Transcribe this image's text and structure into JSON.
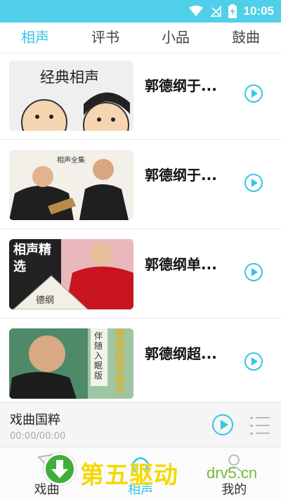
{
  "status_bar": {
    "time": "10:05",
    "icons": [
      "wifi-icon",
      "no-signal-icon",
      "battery-charging-icon"
    ]
  },
  "tabs": [
    {
      "label": "相声",
      "active": true
    },
    {
      "label": "评书",
      "active": false
    },
    {
      "label": "小品",
      "active": false
    },
    {
      "label": "鼓曲",
      "active": false
    }
  ],
  "items": [
    {
      "title": "郭德纲于...",
      "thumb_text": "经典相声",
      "thumb_icon": "cartoon-comedians-thumbnail"
    },
    {
      "title": "郭德纲于...",
      "thumb_text": "相声全集",
      "thumb_icon": "comedians-photo-thumbnail"
    },
    {
      "title": "郭德纲单...",
      "thumb_text": "相声精选",
      "thumb_text2": "德纲",
      "thumb_icon": "comedian-fan-thumbnail"
    },
    {
      "title": "郭德纲超...",
      "thumb_text": "伴随入眠版",
      "thumb_text2": "德纲超清相声",
      "thumb_icon": "comedian-portrait-thumbnail"
    }
  ],
  "player": {
    "title": "戏曲国粹",
    "time": "00:00/00:00",
    "play_icon": "play-circle-icon",
    "playlist_icon": "playlist-icon"
  },
  "bottom_nav": [
    {
      "label": "戏曲",
      "icon": "opera-icon",
      "active": false
    },
    {
      "label": "相声",
      "icon": "headphones-icon",
      "active": true
    },
    {
      "label": "我的",
      "icon": "profile-icon",
      "active": false
    }
  ],
  "watermark": {
    "text": "第五驱动",
    "url": "drv5.cn"
  },
  "colors": {
    "accent": "#34c6e3",
    "status_bar": "#4fd0e8",
    "watermark_yellow": "#f5d800",
    "watermark_green": "#3fae3a"
  }
}
